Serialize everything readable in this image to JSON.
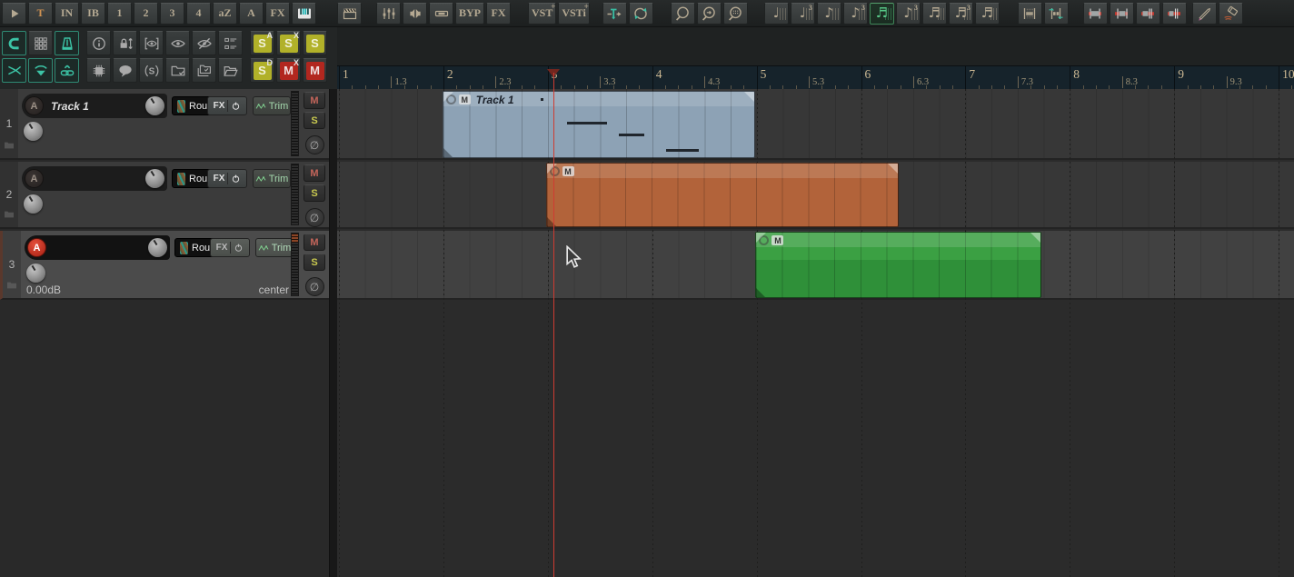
{
  "colors": {
    "accent_teal": "#39bfa3",
    "accent_yellow": "#b1b129",
    "accent_red": "#b2271f",
    "item_blue": "#8da2b5",
    "item_orange": "#b2633a",
    "item_green": "#339a3c",
    "playhead": "#cf3b31",
    "ruler_bg": "#16232b",
    "ruler_text": "#ccb893",
    "grid_selected_green": "#57c787"
  },
  "toolbar_top": {
    "groups": [
      {
        "name": "modes",
        "buttons": [
          {
            "name": "docker-arrow-button",
            "icon": "play"
          },
          {
            "name": "track-mode-button",
            "label": "T",
            "accent": "orange"
          },
          {
            "name": "input-mode-button",
            "label": "IN"
          },
          {
            "name": "input-block-button",
            "label": "IB"
          },
          {
            "name": "mode-1-button",
            "label": "1"
          },
          {
            "name": "mode-2-button",
            "label": "2"
          },
          {
            "name": "mode-3-button",
            "label": "3"
          },
          {
            "name": "mode-4-button",
            "label": "4"
          },
          {
            "name": "autozoom-button",
            "label": "aZ"
          },
          {
            "name": "auto-button",
            "label": "A"
          },
          {
            "name": "fx-mode-button",
            "label": "FX"
          },
          {
            "name": "midi-editor-button",
            "icon": "piano"
          }
        ]
      },
      {
        "name": "media",
        "buttons": [
          {
            "name": "media-explorer-button",
            "icon": "clapper"
          }
        ]
      },
      {
        "name": "monitoring",
        "buttons": [
          {
            "name": "mixer-button",
            "icon": "mixer"
          },
          {
            "name": "monitor-button",
            "icon": "speakers"
          },
          {
            "name": "io-routing-button",
            "icon": "plug"
          },
          {
            "name": "bypass-button",
            "label": "BYP"
          },
          {
            "name": "fx-chain-button",
            "label": "FX"
          }
        ]
      },
      {
        "name": "plugins",
        "buttons": [
          {
            "name": "add-vst-button",
            "label": "VST",
            "sup": "+"
          },
          {
            "name": "add-vsti-button",
            "label": "VSTi",
            "sup": "+"
          }
        ]
      },
      {
        "name": "cursor-tools",
        "buttons": [
          {
            "name": "insert-marker-button",
            "icon": "insmark"
          },
          {
            "name": "loop-toggle-button",
            "icon": "looparr"
          }
        ]
      },
      {
        "name": "zoom-tools",
        "buttons": [
          {
            "name": "zoom-tool-button",
            "icon": "qcircle"
          },
          {
            "name": "zoom-selection-button",
            "icon": "qarrow"
          },
          {
            "name": "zoom-grid-button",
            "icon": "qgrid"
          }
        ]
      },
      {
        "name": "grid-division",
        "buttons": [
          {
            "name": "grid-quarter-button",
            "glyph": "♩"
          },
          {
            "name": "grid-quarter-triplet-button",
            "glyph": "♩",
            "sup": "3"
          },
          {
            "name": "grid-eighth-button",
            "glyph": "♪"
          },
          {
            "name": "grid-eighth-triplet-button",
            "glyph": "♪",
            "sup": "3"
          },
          {
            "name": "grid-sixteenth-button",
            "glyph": "♬",
            "selected": true
          },
          {
            "name": "grid-eighth-triplet-2-button",
            "glyph": "♪",
            "sup": "3"
          },
          {
            "name": "grid-sixteenth-2-button",
            "glyph": "♬"
          },
          {
            "name": "grid-sixteenth-triplet-button",
            "glyph": "♬",
            "sup": "3"
          },
          {
            "name": "grid-thirtysecond-button",
            "glyph": "♬"
          }
        ]
      },
      {
        "name": "item-fit",
        "buttons": [
          {
            "name": "fit-items-button",
            "icon": "gridbar"
          },
          {
            "name": "stretch-items-button",
            "icon": "gridbararr"
          }
        ]
      },
      {
        "name": "item-edit",
        "buttons": [
          {
            "name": "trim-left-button",
            "icon": "red1"
          },
          {
            "name": "trim-center-button",
            "icon": "red2"
          },
          {
            "name": "trim-right-button",
            "icon": "red3"
          },
          {
            "name": "slip-edit-button",
            "icon": "red4"
          }
        ]
      },
      {
        "name": "draw-tools",
        "buttons": [
          {
            "name": "pencil-tool-button",
            "icon": "pencil"
          },
          {
            "name": "eraser-tool-button",
            "icon": "eraser"
          }
        ]
      }
    ]
  },
  "toolbar_left": {
    "rows": [
      [
        {
          "name": "snap-toggle-button",
          "icon": "magnet",
          "selected": true
        },
        {
          "name": "grid-toggle-button",
          "icon": "gridsq"
        },
        {
          "name": "metronome-button",
          "icon": "metronome",
          "selected": true
        },
        {
          "name": "item-info-button",
          "icon": "info"
        },
        {
          "name": "lock-track-heights-button",
          "icon": "lockh"
        },
        {
          "name": "show-all-tracks-button",
          "icon": "eyeb"
        },
        {
          "name": "show-tracks-button",
          "icon": "eye"
        },
        {
          "name": "hide-tracks-button",
          "icon": "eyeslash"
        },
        {
          "name": "track-manager-button",
          "icon": "listit"
        },
        {
          "name": "solo-all-button",
          "label": "S",
          "sup": "A",
          "color": "yellow"
        },
        {
          "name": "unsolo-all-button",
          "label": "S",
          "sup": "X",
          "color": "yellow"
        },
        {
          "name": "solo-toggle-button",
          "label": "S",
          "color": "yellow"
        }
      ],
      [
        {
          "name": "crossfade-toggle-button",
          "icon": "razor",
          "selected": true
        },
        {
          "name": "envelope-visibility-button",
          "icon": "eyew",
          "selected": true
        },
        {
          "name": "item-grouping-button",
          "icon": "chain",
          "selected": true
        },
        {
          "name": "plugin-info-button",
          "icon": "chip"
        },
        {
          "name": "project-notes-button",
          "icon": "bubble"
        },
        {
          "name": "solo-in-front-button",
          "icon": "sbr"
        },
        {
          "name": "folder-collapse-button",
          "icon": "fold1"
        },
        {
          "name": "folders-collapse-button",
          "icon": "fold2"
        },
        {
          "name": "folder-open-button",
          "icon": "fold3"
        },
        {
          "name": "solo-defeat-button",
          "label": "S",
          "sup": "D",
          "color": "yellow"
        },
        {
          "name": "unmute-all-button",
          "label": "M",
          "sup": "X",
          "color": "red"
        },
        {
          "name": "mute-toggle-button",
          "label": "M",
          "color": "red"
        }
      ]
    ]
  },
  "tracks": [
    {
      "number": "1",
      "arm_label": "A",
      "armed": false,
      "selected": false,
      "name": "Track 1",
      "route_label": "Route",
      "fx_label": "FX",
      "trim_label": "Trim",
      "mute_label": "M",
      "solo_label": "S",
      "phase_label": "∅"
    },
    {
      "number": "2",
      "arm_label": "A",
      "armed": false,
      "selected": false,
      "name": "",
      "route_label": "Route",
      "fx_label": "FX",
      "trim_label": "Trim",
      "mute_label": "M",
      "solo_label": "S",
      "phase_label": "∅"
    },
    {
      "number": "3",
      "arm_label": "A",
      "armed": true,
      "selected": true,
      "name": "",
      "route_label": "Route",
      "fx_label": "FX",
      "trim_label": "Trim",
      "mute_label": "M",
      "solo_label": "S",
      "phase_label": "∅",
      "volume_label": "0.00dB",
      "pan_label": "center"
    }
  ],
  "ruler": {
    "major_labels": [
      "1",
      "2",
      "3",
      "4",
      "5",
      "6",
      "7",
      "8",
      "9",
      "10"
    ],
    "minor_labels": [
      "1.3",
      "2.3",
      "3.3",
      "4.3",
      "5.3",
      "6.3",
      "7.3",
      "8.3",
      "9.3"
    ]
  },
  "arrange": {
    "playhead_measure": 3.05,
    "items": [
      {
        "name": "midi-item-track1",
        "track": 0,
        "color": "blue",
        "label": "Track 1",
        "mute_badge": "M",
        "start_measure": 1.99,
        "end_measure": 4.99,
        "notes": [
          {
            "l": 107,
            "t": 7,
            "w": 3
          },
          {
            "l": 136,
            "t": 33,
            "w": 44
          },
          {
            "l": 193,
            "t": 46,
            "w": 28
          },
          {
            "l": 245,
            "t": 63,
            "w": 36
          }
        ]
      },
      {
        "name": "media-item-track2",
        "track": 1,
        "color": "orange",
        "label": "",
        "mute_badge": "M",
        "start_measure": 2.98,
        "end_measure": 6.36,
        "notes": []
      },
      {
        "name": "media-item-track3",
        "track": 2,
        "color": "green",
        "label": "",
        "mute_badge": "M",
        "start_measure": 4.99,
        "end_measure": 7.73,
        "notes": []
      }
    ]
  }
}
